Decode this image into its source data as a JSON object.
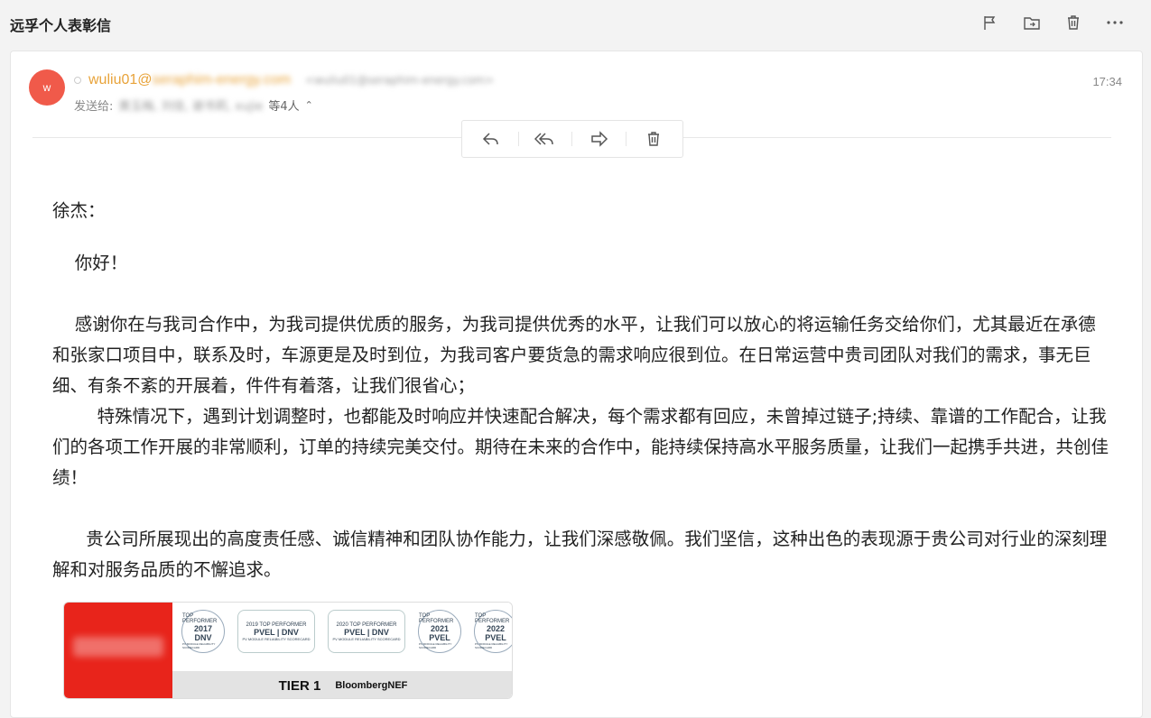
{
  "subject": "远孚个人表彰信",
  "top_actions": [
    {
      "icon": "flag-icon"
    },
    {
      "icon": "move-folder-icon"
    },
    {
      "icon": "trash-icon"
    },
    {
      "icon": "more-icon"
    }
  ],
  "sender": {
    "avatar_letter": "w",
    "name_prefix": "wuliu01@",
    "domain": "seraphim-energy.com",
    "address": "<wuliu01@seraphim-energy.com>",
    "time": "17:34"
  },
  "recipients": {
    "label": "发送给:",
    "names": "黄玉梅, 刘佳, 谢书莉, xujie",
    "count_text": "等4人",
    "expand": "⌃"
  },
  "message_actions": [
    {
      "icon": "reply-icon"
    },
    {
      "icon": "reply-all-icon"
    },
    {
      "icon": "forward-icon"
    },
    {
      "icon": "delete-icon"
    }
  ],
  "body": {
    "greeting_name": "徐杰：",
    "hello": "    你好！",
    "para1": "    感谢你在与我司合作中，为我司提供优质的服务，为我司提供优秀的水平，让我们可以放心的将运输任务交给你们，尤其最近在承德和张家口项目中，联系及时，车源更是及时到位，为我司客户要货急的需求响应很到位。在日常运营中贵司团队对我们的需求，事无巨细、有条不紊的开展着，件件有着落，让我们很省心；",
    "para2": "        特殊情况下，遇到计划调整时，也都能及时响应并快速配合解决，每个需求都有回应，未曾掉过链子;持续、靠谱的工作配合，让我们的各项工作开展的非常顺利，订单的持续完美交付。期待在未来的合作中，能持续保持高水平服务质量，让我们一起携手共进，共创佳绩！",
    "para3": "      贵公司所展现出的高度责任感、诚信精神和团队协作能力，让我们深感敬佩。我们坚信，这种出色的表现源于贵公司对行业的深刻理解和对服务品质的不懈追求。"
  },
  "banner": {
    "badges": [
      {
        "top": "TOP PERFORMER",
        "year": "2017",
        "brand": "DNV",
        "sub": "PV MODULE RELIABILITY SCORECARD"
      },
      {
        "top": "2019 TOP PERFORMER",
        "year": "",
        "brand": "PVEL | DNV",
        "sub": "PV MODULE RELIABILITY SCORECARD"
      },
      {
        "top": "2020 TOP PERFORMER",
        "year": "",
        "brand": "PVEL | DNV",
        "sub": "PV MODULE RELIABILITY SCORECARD"
      },
      {
        "top": "TOP PERFORMER",
        "year": "2021",
        "brand": "PVEL",
        "sub": "PV MODULE RELIABILITY SCORECARD"
      },
      {
        "top": "TOP PERFORMER",
        "year": "2022",
        "brand": "PVEL",
        "sub": "PV MODULE RELIABILITY SCORECARD"
      }
    ],
    "tier": "TIER 1",
    "bnef": "BloombergNEF"
  }
}
